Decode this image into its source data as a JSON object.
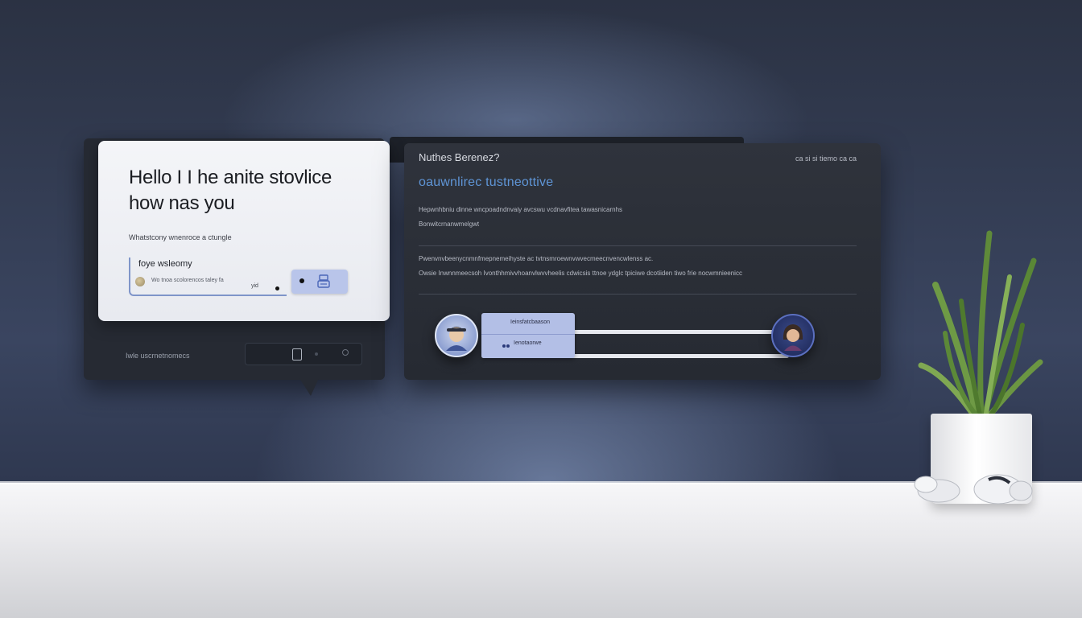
{
  "chat": {
    "greeting": "Hello I I he anite stovlice how nas you",
    "subtitle": "Whatstcony wnenroce a ctungle",
    "input_label": "foye wsleomy",
    "input_hint": "Wo tnoa scolorencos taley fa",
    "input_count": "yid",
    "footer_label": "Iwle uscrnetnomecs"
  },
  "panel": {
    "title": "Nuthes Berenez?",
    "meta": "ca si si tiemo ca ca",
    "heading": "oauwnlirec tustneottive",
    "line_1": "Hepwnhbniu dinne wncpoadndnvaiy avcswu vcdnavfitea tawasnicarnhs",
    "line_2": "Bonwitcrnanwmelgwt",
    "line_3": "Pwenvnvbeenycnmnfmepnemeihyste ac tvtnsmroewnvwvecmeecnvencwlenss ac.",
    "line_4": "Owsie Inwnnmeecsoh Ivonthhmivvhoanvlwvvheelis cdwicsis ttnoe ydglc tpiciwe dcotiiden tiwo frie nocwmnieenicc",
    "bubble_top": "Ieinsfatcbaason",
    "bubble_bottom": "Ienotaorwe"
  },
  "colors": {
    "accent": "#5f95d6",
    "button": "#b9c5ea",
    "panel_bg": "#2a2e36"
  },
  "icons": {
    "send": "send-icon",
    "mic": "mic-icon",
    "avatar_a": "avatar-icon",
    "avatar_b": "avatar-icon",
    "plant": "plant-icon",
    "earbuds": "earbuds-icon"
  }
}
